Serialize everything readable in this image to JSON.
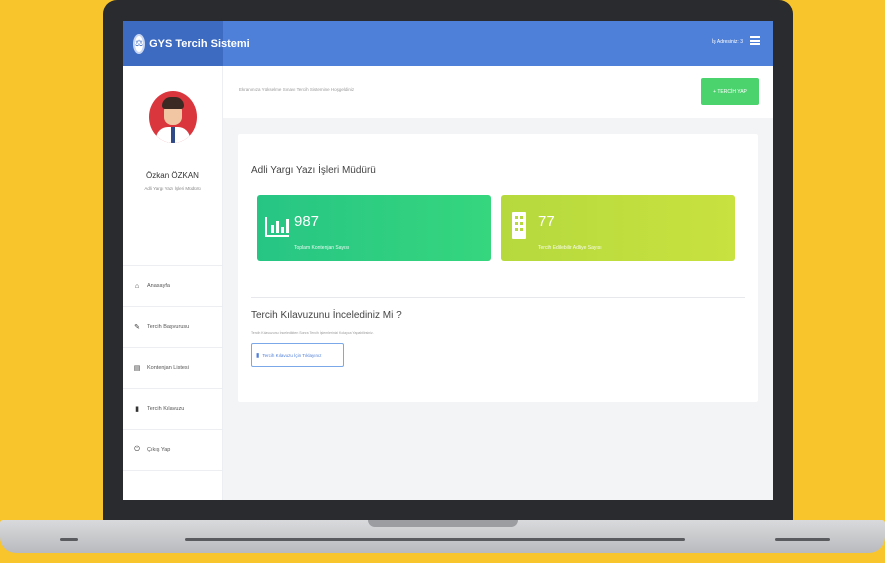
{
  "app": {
    "brand": "GYS Tercih Sistemi",
    "user_label": "İş Adresiniz: 3"
  },
  "sidebar": {
    "profile_name": "Özkan ÖZKAN",
    "profile_title": "Adli Yargı Yazı İşleri Müdürü",
    "items": [
      {
        "label": "Anasayfa",
        "icon": "home-icon"
      },
      {
        "label": "Tercih Başvurusu",
        "icon": "edit-icon"
      },
      {
        "label": "Kontenjan Listesi",
        "icon": "list-icon"
      },
      {
        "label": "Tercih Kılavuzu",
        "icon": "book-icon"
      },
      {
        "label": "Çıkış Yap",
        "icon": "power-icon"
      }
    ]
  },
  "main": {
    "welcome": "Ekranınıza Yükselme Sınavı Tercih Sistemine Hoşgeldiniz",
    "tercih_button": "+ TERCİH YAP",
    "card_title": "Adli Yargı Yazı İşleri Müdürü",
    "stats": [
      {
        "value": "987",
        "label": "Toplam Kontenjan Sayısı",
        "icon": "bar-chart-icon",
        "color": "#27c584"
      },
      {
        "value": "77",
        "label": "Tercih Edilebilir Adliye Sayısı",
        "icon": "building-icon",
        "color": "#b6d93e"
      }
    ],
    "guide_title": "Tercih Kılavuzunu İncelediniz Mi ?",
    "guide_text": "Tercih Kılavuzunu İnceledikten Sonra Tercih İşlemlerinizi Kolayca Yapabilirsiniz.",
    "guide_button": "Tercih Kılavuzu İçin Tıklayınız"
  },
  "colors": {
    "topbar": "#4e7fd9",
    "background": "#f9c52c",
    "button_green": "#4bd36e"
  }
}
